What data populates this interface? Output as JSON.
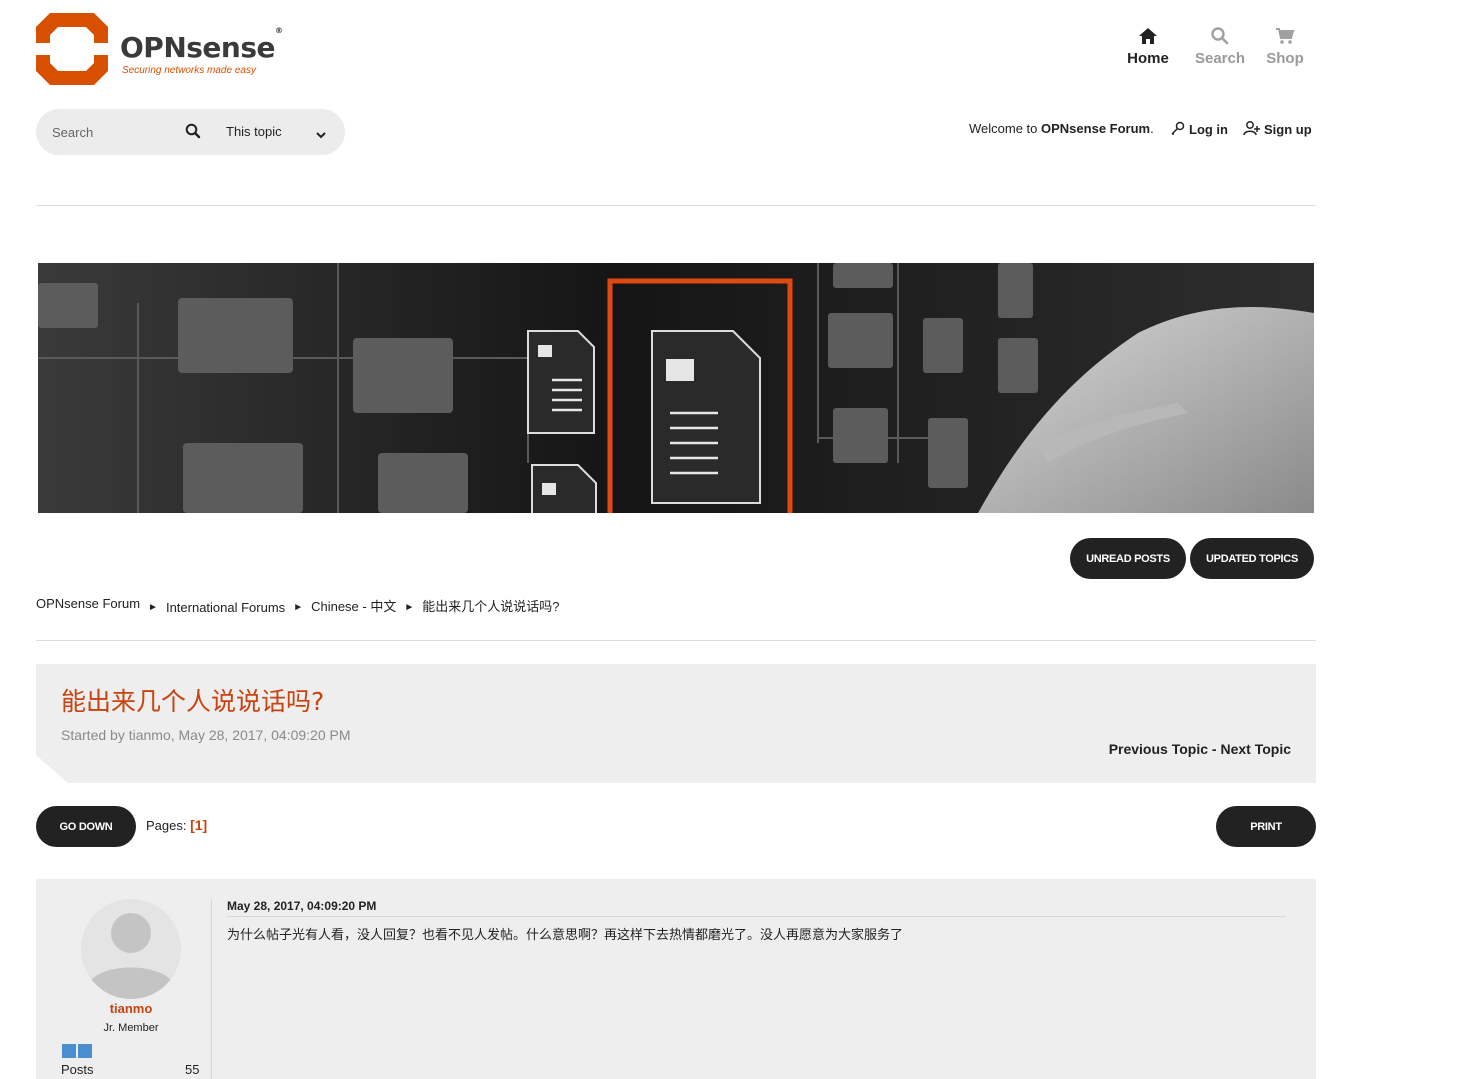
{
  "brand": {
    "name": "OPNsense",
    "registered": "®",
    "tagline": "Securing networks made easy",
    "accent_color": "#d94f00"
  },
  "topnav": {
    "home": "Home",
    "search": "Search",
    "shop": "Shop"
  },
  "search": {
    "placeholder": "Search",
    "scope": "This topic"
  },
  "welcome": {
    "prefix": "Welcome to ",
    "forum_name": "OPNsense Forum",
    "suffix": ".",
    "login": "Log in",
    "signup": "Sign up"
  },
  "actions": {
    "unread_posts": "Unread Posts",
    "updated_topics": "Updated Topics"
  },
  "breadcrumb": {
    "items": [
      "OPNsense Forum",
      "International Forums",
      "Chinese - 中文",
      "能出来几个人说说话吗?"
    ],
    "separator": "►"
  },
  "topic": {
    "title": "能出来几个人说说话吗?",
    "started": "Started by tianmo, May 28, 2017, 04:09:20 PM",
    "previous": "Previous Topic",
    "dash": " - ",
    "next": "Next Topic",
    "title_color": "#c8430f"
  },
  "pagination": {
    "go_down": "Go Down",
    "pages_label": "Pages:",
    "current": "[1]",
    "print": "Print"
  },
  "post": {
    "author": "tianmo",
    "rank": "Jr. Member",
    "posts_label": "Posts",
    "posts_count": "55",
    "date": "May 28, 2017, 04:09:20 PM",
    "body": "为什么帖子光有人看，没人回复？也看不见人发帖。什么意思啊？再这样下去热情都磨光了。没人再愿意为大家服务了"
  }
}
